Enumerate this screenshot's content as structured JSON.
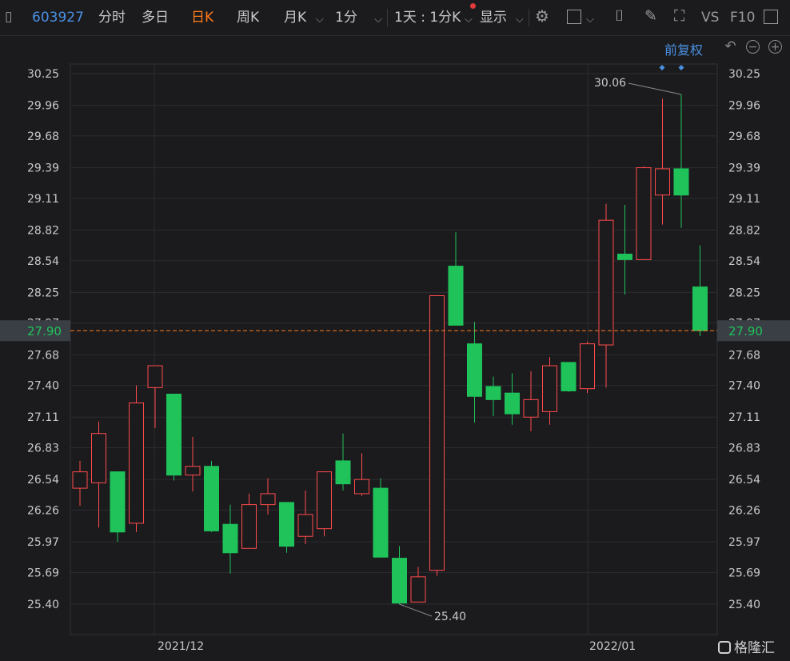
{
  "toolbar": {
    "stock_code": "603927",
    "tabs": [
      "分时",
      "多日",
      "日K",
      "周K",
      "月K",
      "1分"
    ],
    "period_selector": "1天 : 1分K",
    "display_label": "显示",
    "vs_label": "VS",
    "f10_label": "F10",
    "accent_color": "#ff7a1a",
    "code_color": "#4a90e2"
  },
  "chart_controls": {
    "adjust_label": "前复权"
  },
  "y_ticks": [
    "30.25",
    "29.96",
    "29.68",
    "29.39",
    "29.11",
    "28.82",
    "28.54",
    "28.25",
    "27.97",
    "27.68",
    "27.40",
    "27.11",
    "26.83",
    "26.54",
    "26.26",
    "25.97",
    "25.69",
    "25.40"
  ],
  "x_labels": [
    "2021/12",
    "2022/01"
  ],
  "current_price": "27.90",
  "watermark": "格隆汇",
  "chart_data": {
    "type": "candlestick",
    "ylim": [
      25.25,
      30.35
    ],
    "grid": true,
    "annotations": [
      {
        "text": "30.06",
        "value": 30.06,
        "candle": 32
      },
      {
        "text": "25.40",
        "value": 25.4,
        "candle": 17
      }
    ],
    "colors": {
      "up": "#ff4b4b",
      "down": "#1fc35a"
    },
    "candles": [
      {
        "o": 26.46,
        "h": 26.71,
        "l": 26.3,
        "c": 26.61
      },
      {
        "o": 26.51,
        "h": 27.07,
        "l": 26.1,
        "c": 26.96
      },
      {
        "o": 26.61,
        "h": 26.61,
        "l": 25.97,
        "c": 26.06
      },
      {
        "o": 26.14,
        "h": 27.4,
        "l": 26.06,
        "c": 27.24
      },
      {
        "o": 27.38,
        "h": 27.58,
        "l": 27.01,
        "c": 27.58
      },
      {
        "o": 27.32,
        "h": 27.32,
        "l": 26.53,
        "c": 26.58
      },
      {
        "o": 26.58,
        "h": 26.93,
        "l": 26.43,
        "c": 26.66
      },
      {
        "o": 26.66,
        "h": 26.71,
        "l": 26.06,
        "c": 26.07
      },
      {
        "o": 26.13,
        "h": 26.31,
        "l": 25.68,
        "c": 25.87
      },
      {
        "o": 25.91,
        "h": 26.41,
        "l": 25.91,
        "c": 26.31
      },
      {
        "o": 26.31,
        "h": 26.55,
        "l": 26.22,
        "c": 26.41
      },
      {
        "o": 26.33,
        "h": 26.33,
        "l": 25.87,
        "c": 25.93
      },
      {
        "o": 26.02,
        "h": 26.44,
        "l": 25.95,
        "c": 26.22
      },
      {
        "o": 26.09,
        "h": 26.61,
        "l": 26.02,
        "c": 26.61
      },
      {
        "o": 26.71,
        "h": 26.96,
        "l": 26.44,
        "c": 26.5
      },
      {
        "o": 26.41,
        "h": 26.78,
        "l": 26.39,
        "c": 26.54
      },
      {
        "o": 26.46,
        "h": 26.55,
        "l": 25.83,
        "c": 25.83
      },
      {
        "o": 25.82,
        "h": 25.93,
        "l": 25.4,
        "c": 25.41
      },
      {
        "o": 25.42,
        "h": 25.74,
        "l": 25.42,
        "c": 25.65
      },
      {
        "o": 25.71,
        "h": 28.22,
        "l": 25.66,
        "c": 28.22
      },
      {
        "o": 28.49,
        "h": 28.8,
        "l": 27.95,
        "c": 27.95
      },
      {
        "o": 27.78,
        "h": 27.98,
        "l": 27.06,
        "c": 27.3
      },
      {
        "o": 27.39,
        "h": 27.48,
        "l": 27.12,
        "c": 27.27
      },
      {
        "o": 27.33,
        "h": 27.51,
        "l": 27.04,
        "c": 27.14
      },
      {
        "o": 27.11,
        "h": 27.53,
        "l": 26.98,
        "c": 27.27
      },
      {
        "o": 27.16,
        "h": 27.66,
        "l": 27.04,
        "c": 27.58
      },
      {
        "o": 27.61,
        "h": 27.61,
        "l": 27.34,
        "c": 27.35
      },
      {
        "o": 27.37,
        "h": 27.8,
        "l": 27.33,
        "c": 27.78
      },
      {
        "o": 27.77,
        "h": 29.06,
        "l": 27.38,
        "c": 28.91
      },
      {
        "o": 28.6,
        "h": 29.05,
        "l": 28.23,
        "c": 28.55
      },
      {
        "o": 28.55,
        "h": 29.4,
        "l": 28.55,
        "c": 29.39
      },
      {
        "o": 29.14,
        "h": 30.02,
        "l": 28.87,
        "c": 29.38
      },
      {
        "o": 29.38,
        "h": 30.06,
        "l": 28.84,
        "c": 29.14
      },
      {
        "o": 28.3,
        "h": 28.68,
        "l": 27.85,
        "c": 27.9
      }
    ]
  }
}
